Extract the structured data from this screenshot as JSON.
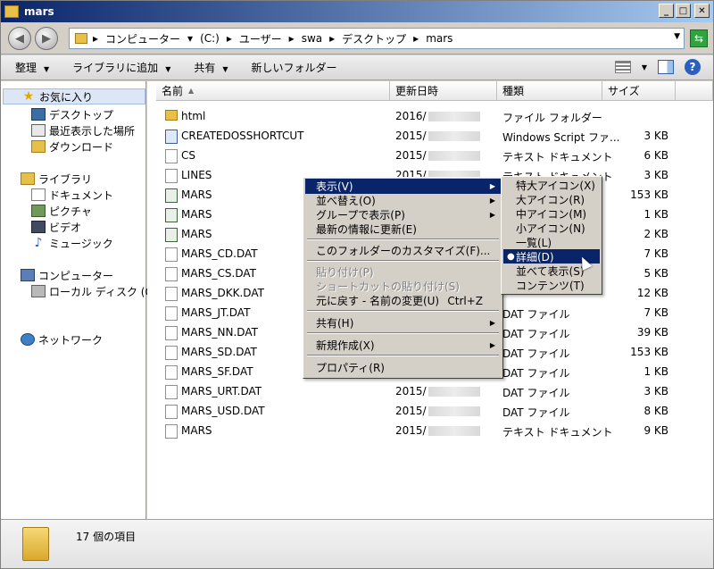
{
  "window": {
    "title": "mars"
  },
  "address": {
    "crumbs": [
      "コンピューター",
      "(C:)",
      "ユーザー",
      "swa",
      "デスクトップ",
      "mars"
    ]
  },
  "toolbar": {
    "organize": "整理",
    "add_to_library": "ライブラリに追加",
    "share": "共有",
    "new_folder": "新しいフォルダー"
  },
  "nav": {
    "favorites": "お気に入り",
    "desktop": "デスクトップ",
    "recent": "最近表示した場所",
    "downloads": "ダウンロード",
    "libraries": "ライブラリ",
    "documents": "ドキュメント",
    "pictures": "ピクチャ",
    "videos": "ビデオ",
    "music": "ミュージック",
    "computer": "コンピューター",
    "local_disk": "ローカル ディスク (C:)",
    "network": "ネットワーク"
  },
  "columns": {
    "name": "名前",
    "modified": "更新日時",
    "type": "種類",
    "size": "サイズ"
  },
  "files": [
    {
      "name": "html",
      "date": "2016/",
      "type": "ファイル フォルダー",
      "size": ""
    },
    {
      "name": "CREATEDOSSHORTCUT",
      "date": "2015/",
      "type": "Windows Script ファ...",
      "size": "3 KB"
    },
    {
      "name": "CS",
      "date": "2015/",
      "type": "テキスト ドキュメント",
      "size": "6 KB"
    },
    {
      "name": "LINES",
      "date": "2015/",
      "type": "テキスト ドキュメント",
      "size": "3 KB"
    },
    {
      "name": "MARS",
      "date": "",
      "type": "",
      "size": "153 KB"
    },
    {
      "name": "MARS",
      "date": "",
      "type": "",
      "size": "1 KB"
    },
    {
      "name": "MARS",
      "date": "",
      "type": "",
      "size": "2 KB"
    },
    {
      "name": "MARS_CD.DAT",
      "date": "",
      "type": "",
      "size": "7 KB"
    },
    {
      "name": "MARS_CS.DAT",
      "date": "",
      "type": "",
      "size": "5 KB"
    },
    {
      "name": "MARS_DKK.DAT",
      "date": "",
      "type": "",
      "size": "12 KB"
    },
    {
      "name": "MARS_JT.DAT",
      "date": "",
      "type": "DAT ファイル",
      "size": "7 KB"
    },
    {
      "name": "MARS_NN.DAT",
      "date": "",
      "type": "DAT ファイル",
      "size": "39 KB"
    },
    {
      "name": "MARS_SD.DAT",
      "date": "",
      "type": "DAT ファイル",
      "size": "153 KB"
    },
    {
      "name": "MARS_SF.DAT",
      "date": "",
      "type": "DAT ファイル",
      "size": "1 KB"
    },
    {
      "name": "MARS_URT.DAT",
      "date": "2015/",
      "type": "DAT ファイル",
      "size": "3 KB"
    },
    {
      "name": "MARS_USD.DAT",
      "date": "2015/",
      "type": "DAT ファイル",
      "size": "8 KB"
    },
    {
      "name": "MARS",
      "date": "2015/",
      "type": "テキスト ドキュメント",
      "size": "9 KB"
    }
  ],
  "status": {
    "count": "17 個の項目"
  },
  "context_menu": {
    "view": "表示(V)",
    "sort": "並べ替え(O)",
    "group": "グループで表示(P)",
    "refresh": "最新の情報に更新(E)",
    "customize": "このフォルダーのカスタマイズ(F)...",
    "paste": "貼り付け(P)",
    "paste_shortcut": "ショートカットの貼り付け(S)",
    "undo": "元に戻す - 名前の変更(U)",
    "undo_shortcut": "Ctrl+Z",
    "share": "共有(H)",
    "new": "新規作成(X)",
    "properties": "プロパティ(R)"
  },
  "view_submenu": {
    "extra_large": "特大アイコン(X)",
    "large": "大アイコン(R)",
    "medium": "中アイコン(M)",
    "small": "小アイコン(N)",
    "list": "一覧(L)",
    "details": "詳細(D)",
    "tiles": "並べて表示(S)",
    "content": "コンテンツ(T)"
  }
}
